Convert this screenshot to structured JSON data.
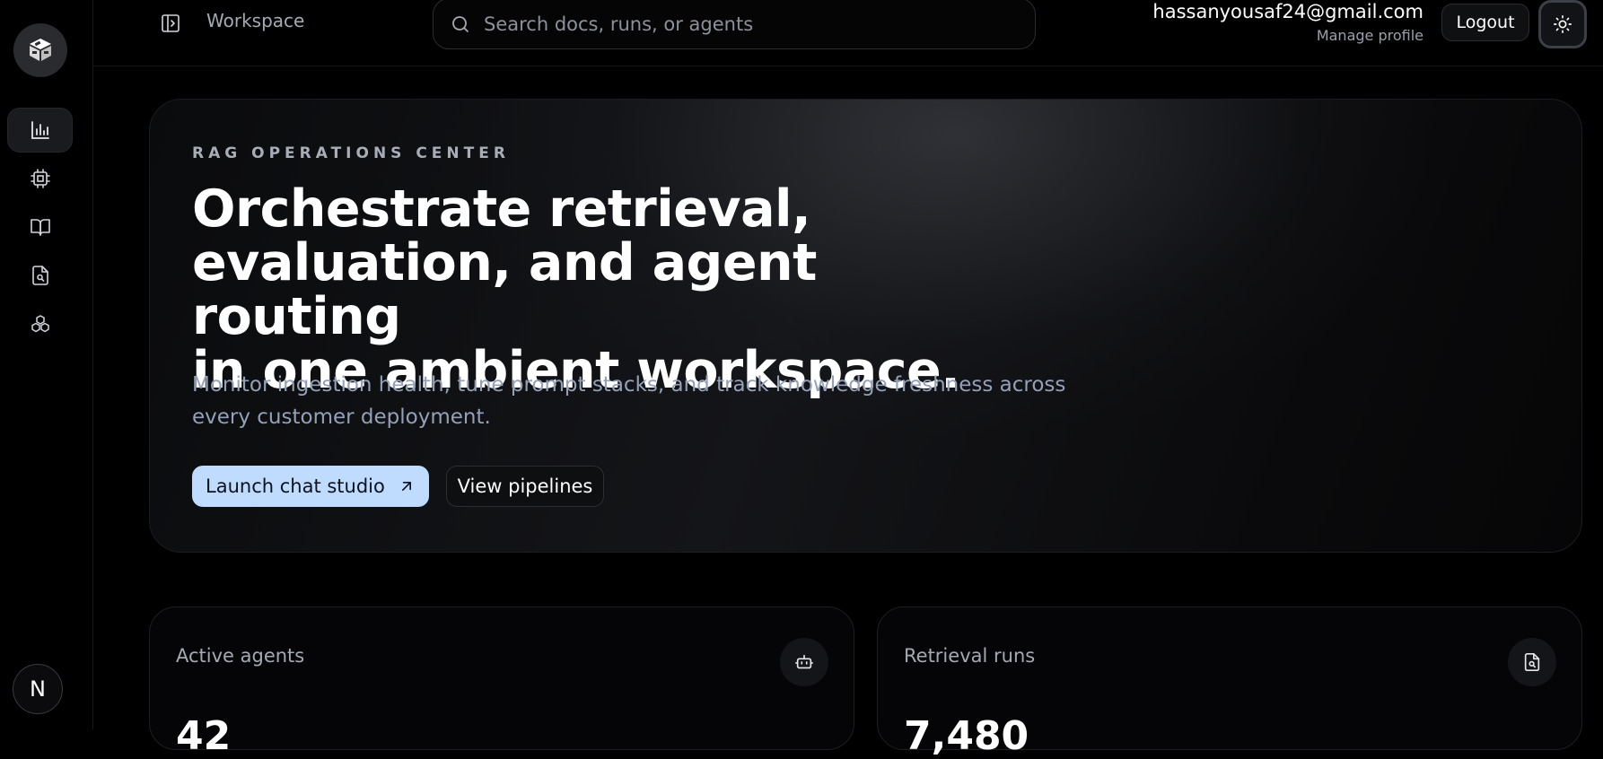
{
  "sidebar": {
    "logo_icon": "cube-stack-icon",
    "items": [
      {
        "icon": "bar-chart-icon",
        "active": true
      },
      {
        "icon": "cpu-chip-icon",
        "active": false
      },
      {
        "icon": "open-book-icon",
        "active": false
      },
      {
        "icon": "document-search-icon",
        "active": false
      },
      {
        "icon": "cubes-network-icon",
        "active": false
      }
    ],
    "avatar_letter": "N"
  },
  "topbar": {
    "workspace_label": "Workspace",
    "search_placeholder": "Search docs, runs, or agents",
    "user_email": "hassanyousaf24@gmail.com",
    "manage_profile": "Manage profile",
    "logout_label": "Logout"
  },
  "hero": {
    "eyebrow": "RAG OPERATIONS CENTER",
    "title_line1": "Orchestrate retrieval,",
    "title_line2": "evaluation, and agent routing",
    "title_line3": "in one ambient workspace.",
    "subtitle": "Monitor ingestion health, tune prompt stacks, and track knowledge freshness across every customer deployment.",
    "primary_label": "Launch chat studio",
    "secondary_label": "View pipelines"
  },
  "cards": [
    {
      "title": "Active agents",
      "value": "42",
      "icon": "robot-icon"
    },
    {
      "title": "Retrieval runs",
      "value": "7,480",
      "icon": "document-search-icon"
    }
  ],
  "colors": {
    "background": "#000000",
    "accent": "#bfdbfe",
    "muted_text": "#a4a9b3",
    "subtitle_text": "#93a0b8"
  }
}
